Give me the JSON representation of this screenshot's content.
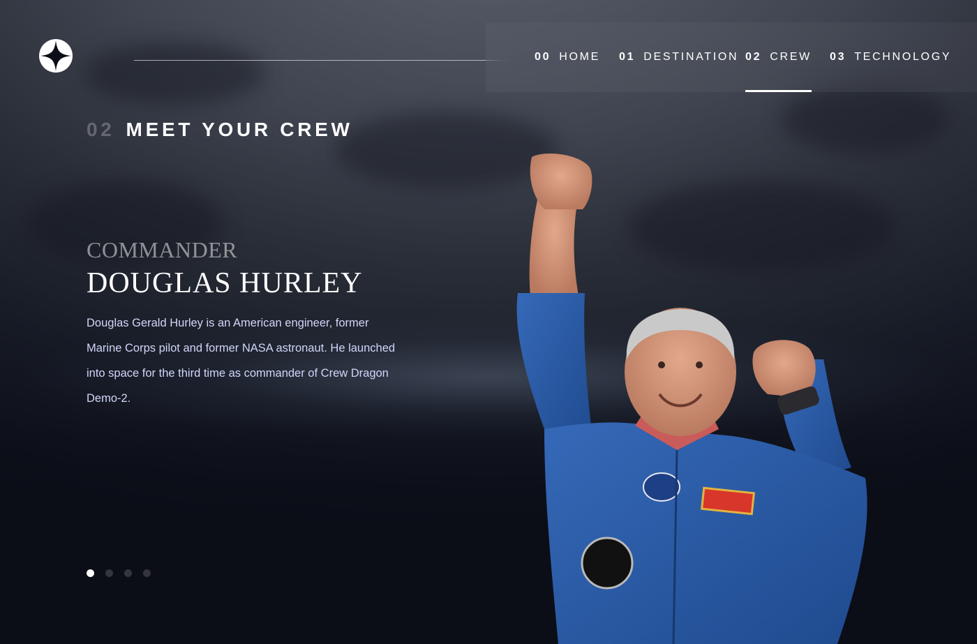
{
  "header": {
    "logo": "star-logo-icon",
    "nav": [
      {
        "num": "00",
        "label": "HOME"
      },
      {
        "num": "01",
        "label": "DESTINATION"
      },
      {
        "num": "02",
        "label": "CREW"
      },
      {
        "num": "03",
        "label": "TECHNOLOGY"
      }
    ],
    "active_index": 2
  },
  "main": {
    "heading_num": "02",
    "heading": "MEET YOUR CREW",
    "role": "COMMANDER",
    "name": "DOUGLAS HURLEY",
    "bio": "Douglas Gerald Hurley is an American engineer, former Marine Corps pilot and former NASA astronaut. He launched into space for the third time as commander of Crew Dragon Demo-2.",
    "slides_count": 4,
    "active_slide": 0,
    "image_icon": "astronaut-photo"
  },
  "colors": {
    "background": "#0b0d17",
    "bio_text": "#d0d6f9",
    "suit_blue": "#2a5aa8"
  }
}
